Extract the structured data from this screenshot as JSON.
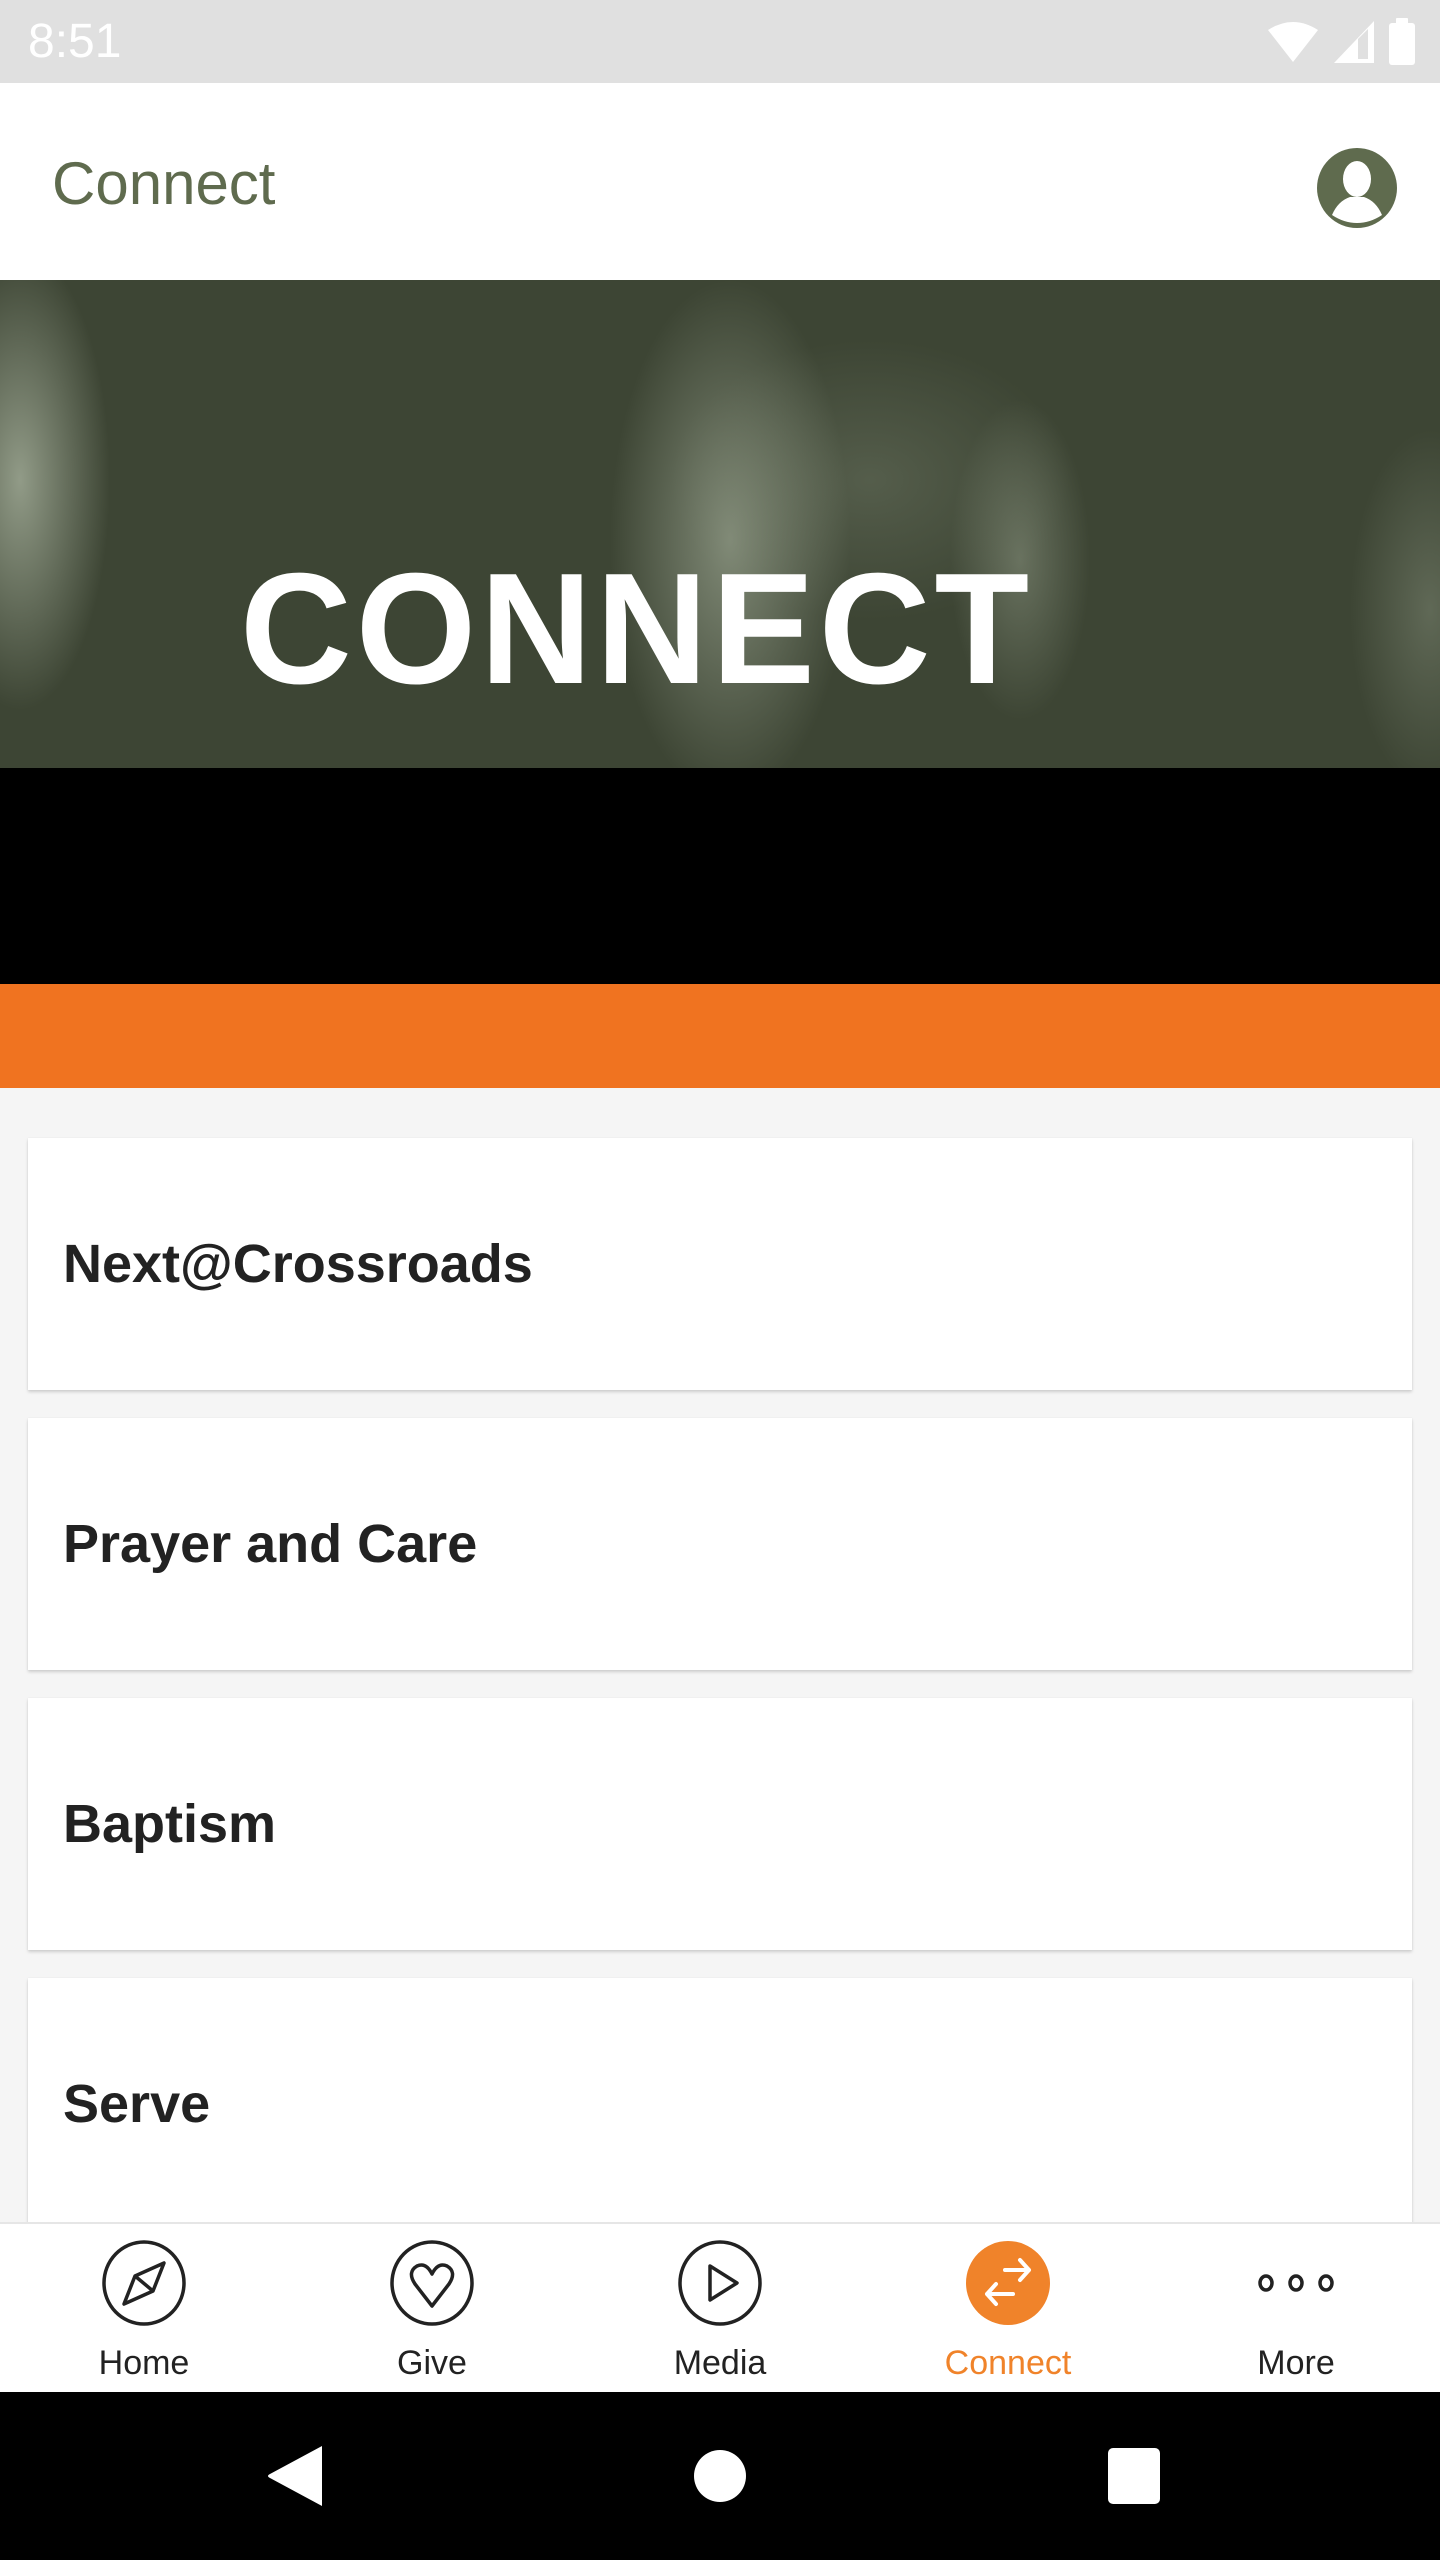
{
  "status_bar": {
    "time": "8:51",
    "icons": [
      "wifi-icon",
      "cell-signal-icon",
      "battery-icon"
    ]
  },
  "app_bar": {
    "title": "Connect",
    "profile_icon": "account-circle-icon",
    "title_color": "#5f6b4e"
  },
  "hero": {
    "title": "CONNECT",
    "accent_color": "#f07320"
  },
  "list": {
    "items": [
      {
        "label": "Next@Crossroads"
      },
      {
        "label": "Prayer and Care"
      },
      {
        "label": "Baptism"
      },
      {
        "label": "Serve"
      }
    ]
  },
  "bottom_nav": {
    "active_color": "#f0832a",
    "items": [
      {
        "label": "Home",
        "icon": "compass-icon",
        "active": false
      },
      {
        "label": "Give",
        "icon": "heart-icon",
        "active": false
      },
      {
        "label": "Media",
        "icon": "play-icon",
        "active": false
      },
      {
        "label": "Connect",
        "icon": "swap-arrows-icon",
        "active": true
      },
      {
        "label": "More",
        "icon": "more-dots-icon",
        "active": false
      }
    ]
  },
  "system_nav": {
    "buttons": [
      "back-icon",
      "home-icon",
      "recents-icon"
    ]
  }
}
